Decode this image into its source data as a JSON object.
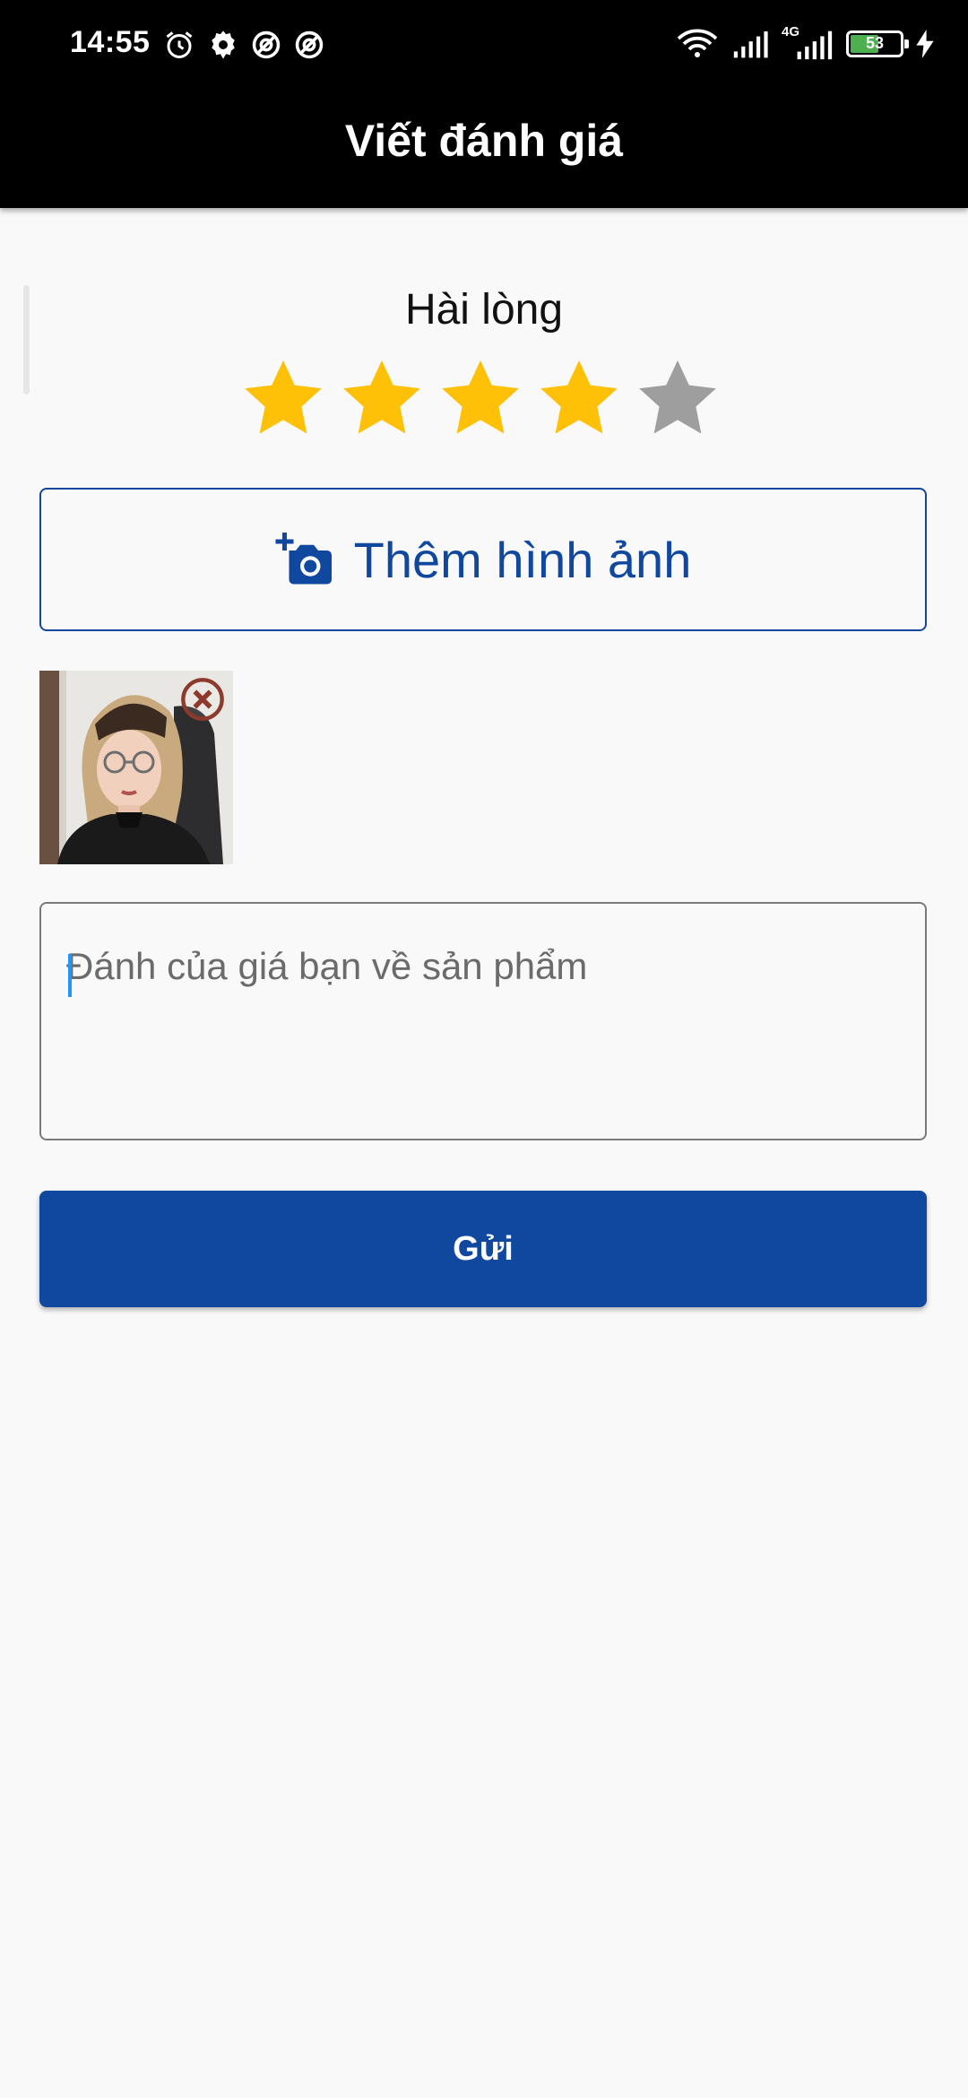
{
  "status_bar": {
    "time": "14:55",
    "left_icons": [
      "alarm-icon",
      "settings-icon",
      "app-notification-icon",
      "app-notification-icon"
    ],
    "network_label": "4G",
    "battery_level": "53",
    "right_icons": [
      "wifi-icon",
      "signal-icon",
      "signal-4g-icon",
      "battery-icon",
      "charging-icon"
    ]
  },
  "app_bar": {
    "title": "Viết đánh giá"
  },
  "rating": {
    "label": "Hài lòng",
    "value": 4,
    "max": 5,
    "filled_color": "#FFC107",
    "empty_color": "#9E9E9E"
  },
  "add_photo": {
    "label": "Thêm hình ảnh",
    "icon": "add-camera-icon",
    "color": "#10479F"
  },
  "photos": [
    {
      "remove_icon": "remove-circle-icon"
    }
  ],
  "review_input": {
    "placeholder": "Đánh của giá bạn về sản phẩm",
    "value": ""
  },
  "submit": {
    "label": "Gửi",
    "color": "#10479F"
  }
}
